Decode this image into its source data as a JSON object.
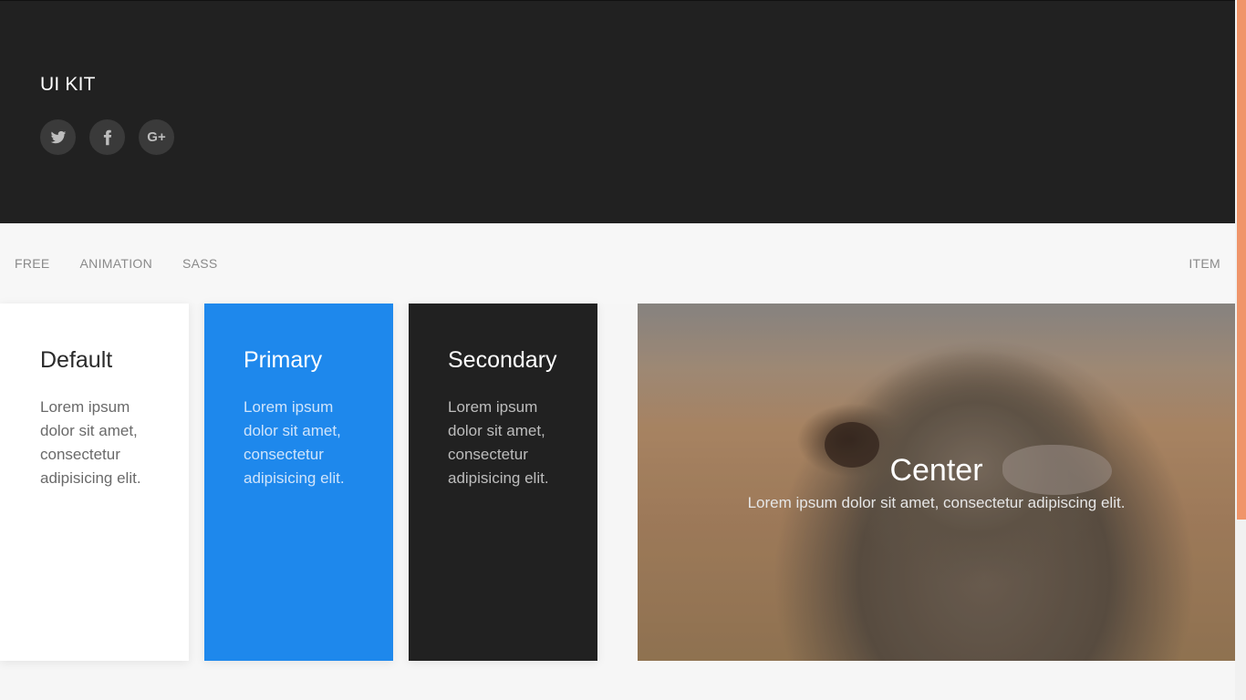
{
  "header": {
    "brand": "UI KIT",
    "social": [
      {
        "icon": "twitter-icon"
      },
      {
        "icon": "facebook-icon"
      },
      {
        "icon": "google-plus-icon",
        "glyph": "G+"
      }
    ],
    "background": "#212121"
  },
  "navbar": {
    "items": [
      "FREE",
      "ANIMATION",
      "SASS"
    ],
    "right_item": "ITEM"
  },
  "cards": {
    "default": {
      "title": "Default",
      "text": "Lorem ipsum dolor sit amet, consectetur adipisicing elit."
    },
    "primary": {
      "title": "Primary",
      "text": "Lorem ipsum dolor sit amet, consectetur adipisicing elit.",
      "color": "#1e88ec"
    },
    "secondary": {
      "title": "Secondary",
      "text": "Lorem ipsum dolor sit amet, consectetur adipisicing elit.",
      "color": "#212121"
    }
  },
  "image_card": {
    "title": "Center",
    "text": "Lorem ipsum dolor sit amet, consectetur adipiscing elit."
  },
  "colors": {
    "accent": "#f0956a"
  }
}
